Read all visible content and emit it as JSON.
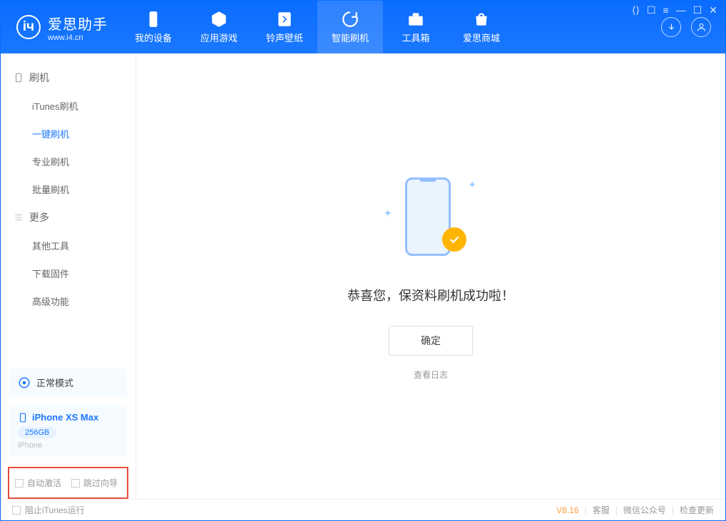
{
  "app": {
    "title": "爱思助手",
    "subtitle": "www.i4.cn"
  },
  "nav": {
    "items": [
      {
        "label": "我的设备",
        "icon": "device"
      },
      {
        "label": "应用游戏",
        "icon": "cube"
      },
      {
        "label": "铃声壁纸",
        "icon": "music"
      },
      {
        "label": "智能刷机",
        "icon": "refresh"
      },
      {
        "label": "工具箱",
        "icon": "toolbox"
      },
      {
        "label": "爱思商城",
        "icon": "bag"
      }
    ],
    "active_index": 3
  },
  "sidebar": {
    "group1_title": "刷机",
    "group1_items": [
      "iTunes刷机",
      "一键刷机",
      "专业刷机",
      "批量刷机"
    ],
    "group1_active": 1,
    "group2_title": "更多",
    "group2_items": [
      "其他工具",
      "下载固件",
      "高级功能"
    ],
    "mode_card": "正常模式",
    "device": {
      "name": "iPhone XS Max",
      "storage": "256GB",
      "type": "iPhone"
    },
    "options": {
      "auto_activate": "自动激活",
      "skip_guide": "跳过向导"
    }
  },
  "main": {
    "success_message": "恭喜您，保资料刷机成功啦！",
    "ok_button": "确定",
    "view_log": "查看日志"
  },
  "footer": {
    "block_itunes": "阻止iTunes运行",
    "version": "V8.16",
    "links": [
      "客服",
      "微信公众号",
      "检查更新"
    ]
  }
}
